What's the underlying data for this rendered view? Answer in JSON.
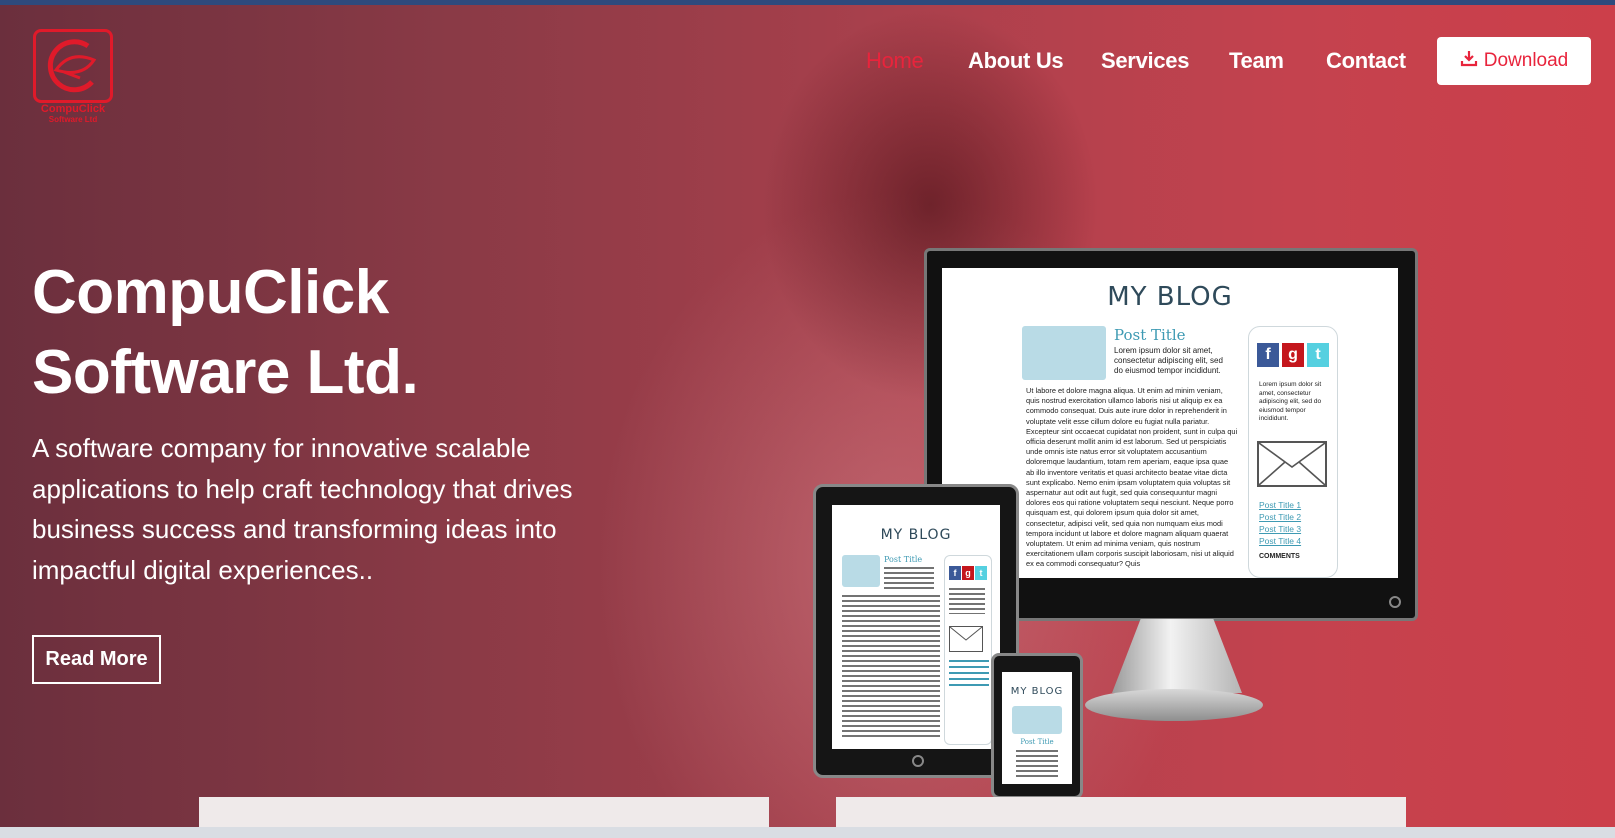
{
  "logo": {
    "brand": "CompuClick",
    "sub": "Software Ltd"
  },
  "nav": {
    "items": [
      "Home",
      "About Us",
      "Services",
      "Team",
      "Contact"
    ],
    "active": "Home",
    "download_label": "Download"
  },
  "hero": {
    "title_line1": "CompuClick",
    "title_line2": "Software Ltd.",
    "description": "A software company for innovative scalable applications to help craft technology that drives business success and transforming ideas into impactful digital experiences..",
    "read_more": "Read More"
  },
  "mockup": {
    "blog_title": "MY BLOG",
    "post_title": "Post Title",
    "post_intro": "Lorem ipsum dolor sit amet, consectetur adipiscing elit, sed do eiusmod tempor incididunt.",
    "post_body": "Ut labore et dolore magna aliqua. Ut enim ad minim veniam, quis nostrud exercitation ullamco laboris nisi ut aliquip ex ea commodo consequat. Duis aute irure dolor in reprehenderit in voluptate velit esse cillum dolore eu fugiat nulla pariatur. Excepteur sint occaecat cupidatat non proident, sunt in culpa qui officia deserunt mollit anim id est laborum. Sed ut perspiciatis unde omnis iste natus error sit voluptatem accusantium doloremque laudantium, totam rem aperiam, eaque ipsa quae ab illo inventore veritatis et quasi architecto beatae vitae dicta sunt explicabo. Nemo enim ipsam voluptatem quia voluptas sit aspernatur aut odit aut fugit, sed quia consequuntur magni dolores eos qui ratione voluptatem sequi nesciunt. Neque porro quisquam est, qui dolorem ipsum quia dolor sit amet, consectetur, adipisci velit, sed quia non numquam eius modi tempora incidunt ut labore et dolore magnam aliquam quaerat voluptatem. Ut enim ad minima veniam, quis nostrum exercitationem ullam corporis suscipit laboriosam, nisi ut aliquid ex ea commodi consequatur? Quis",
    "side_text": "Lorem ipsum dolor sit amet, consectetur adipiscing elit, sed do eiusmod tempor incididunt.",
    "social": [
      "f",
      "g",
      "t"
    ],
    "links": [
      "Post Title 1",
      "Post Title 2",
      "Post Title 3",
      "Post Title 4"
    ],
    "comments": "COMMENTS"
  },
  "colors": {
    "accent": "#e8243c",
    "facebook": "#3b5998",
    "google": "#c4161c",
    "twitter": "#55d0e0"
  }
}
